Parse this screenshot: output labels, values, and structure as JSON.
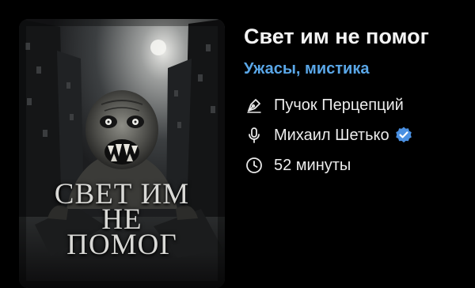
{
  "book": {
    "title": "Свет им не помог",
    "genres": "Ужасы, мистика",
    "cover_title_lines": [
      "СВЕТ ИМ",
      "НЕ",
      "ПОМОГ"
    ]
  },
  "meta": {
    "author": {
      "icon": "pen-nib-icon",
      "text": "Пучок Перцепций"
    },
    "narrator": {
      "icon": "microphone-icon",
      "text": "Михаил Шетько",
      "verified": true,
      "verified_icon": "verified-badge-icon"
    },
    "duration": {
      "icon": "clock-icon",
      "text": "52 минуты"
    }
  },
  "colors": {
    "background": "#000000",
    "accent": "#5aa7e8",
    "verified_badge": "#4a90e2",
    "text": "#f2f2f2"
  }
}
